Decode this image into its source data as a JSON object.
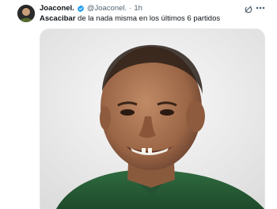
{
  "tweet": {
    "author_name": "Joaconel.",
    "author_handle": "@Joaconel.",
    "separator": "·",
    "time": "1h",
    "text_bold": "Ascacibar",
    "text_rest": " de la nada misma en los últimos 6 partidos"
  },
  "icons": {
    "verified": "verified-badge-icon",
    "grok": "grok-icon",
    "more": "more-options-icon"
  },
  "colors": {
    "verified_blue": "#1d9bf0",
    "secondary_text": "#536471",
    "primary_text": "#0f1419"
  }
}
